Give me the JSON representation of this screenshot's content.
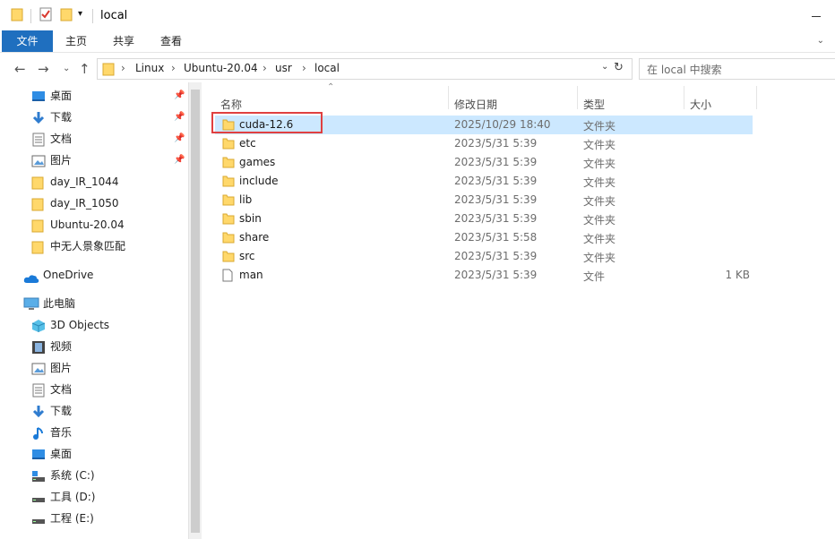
{
  "window": {
    "title": "local"
  },
  "ribbon": {
    "tabs": [
      "文件",
      "主页",
      "共享",
      "查看"
    ]
  },
  "address": {
    "breadcrumbs": [
      "Linux",
      "Ubuntu-20.04",
      "usr",
      "local"
    ],
    "search_placeholder": "在 local 中搜索"
  },
  "nav": {
    "quick_access": [
      {
        "label": "桌面",
        "icon": "desktop-icon",
        "pinned": true
      },
      {
        "label": "下载",
        "icon": "download-icon",
        "pinned": true
      },
      {
        "label": "文档",
        "icon": "document-icon",
        "pinned": true
      },
      {
        "label": "图片",
        "icon": "picture-icon",
        "pinned": true
      },
      {
        "label": "day_IR_1044",
        "icon": "folder-icon",
        "pinned": false
      },
      {
        "label": "day_IR_1050",
        "icon": "folder-icon",
        "pinned": false
      },
      {
        "label": "Ubuntu-20.04",
        "icon": "folder-icon",
        "pinned": false
      },
      {
        "label": "中无人景象匹配",
        "icon": "folder-icon",
        "pinned": false
      }
    ],
    "onedrive": "OneDrive",
    "this_pc": "此电脑",
    "pc_items": [
      {
        "label": "3D Objects",
        "icon": "3d-objects-icon"
      },
      {
        "label": "视频",
        "icon": "video-icon"
      },
      {
        "label": "图片",
        "icon": "picture-icon"
      },
      {
        "label": "文档",
        "icon": "document-icon"
      },
      {
        "label": "下载",
        "icon": "download-icon"
      },
      {
        "label": "音乐",
        "icon": "music-icon"
      },
      {
        "label": "桌面",
        "icon": "desktop-icon"
      },
      {
        "label": "系统 (C:)",
        "icon": "drive-icon"
      },
      {
        "label": "工具 (D:)",
        "icon": "drive-icon"
      },
      {
        "label": "工程 (E:)",
        "icon": "drive-icon"
      }
    ]
  },
  "columns": {
    "name": "名称",
    "date": "修改日期",
    "type": "类型",
    "size": "大小"
  },
  "files": [
    {
      "name": "cuda-12.6",
      "date": "2025/10/29 18:40",
      "type": "文件夹",
      "size": "",
      "kind": "folder",
      "selected": true
    },
    {
      "name": "etc",
      "date": "2023/5/31 5:39",
      "type": "文件夹",
      "size": "",
      "kind": "folder"
    },
    {
      "name": "games",
      "date": "2023/5/31 5:39",
      "type": "文件夹",
      "size": "",
      "kind": "folder"
    },
    {
      "name": "include",
      "date": "2023/5/31 5:39",
      "type": "文件夹",
      "size": "",
      "kind": "folder"
    },
    {
      "name": "lib",
      "date": "2023/5/31 5:39",
      "type": "文件夹",
      "size": "",
      "kind": "folder"
    },
    {
      "name": "sbin",
      "date": "2023/5/31 5:39",
      "type": "文件夹",
      "size": "",
      "kind": "folder"
    },
    {
      "name": "share",
      "date": "2023/5/31 5:58",
      "type": "文件夹",
      "size": "",
      "kind": "folder"
    },
    {
      "name": "src",
      "date": "2023/5/31 5:39",
      "type": "文件夹",
      "size": "",
      "kind": "folder"
    },
    {
      "name": "man",
      "date": "2023/5/31 5:39",
      "type": "文件",
      "size": "1 KB",
      "kind": "file"
    }
  ],
  "colors": {
    "accent": "#1f6fbf",
    "selection": "#cce8ff",
    "folder": "#ffd86b",
    "highlight": "#e04040"
  }
}
